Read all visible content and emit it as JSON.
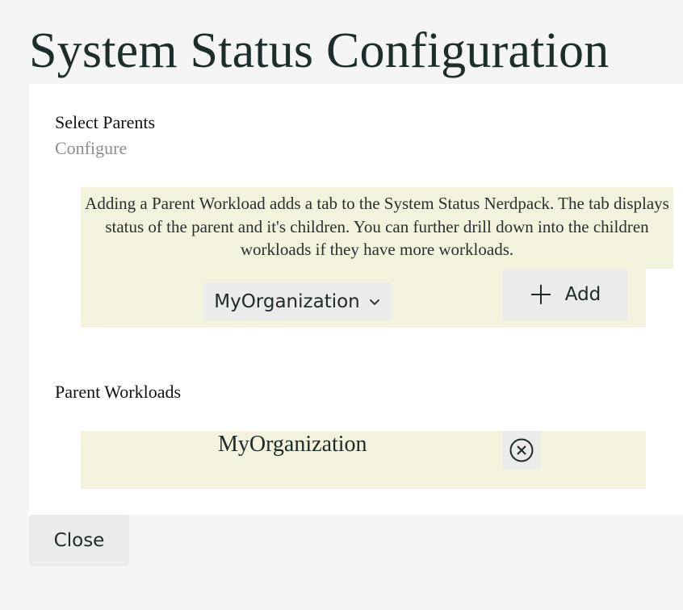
{
  "page": {
    "title": "System Status Configuration"
  },
  "select_parents": {
    "heading": "Select Parents",
    "subheading": "Configure",
    "info_text": "Adding a Parent Workload adds a tab to the System Status Nerdpack. The tab displays status of the parent and it's children. You can further drill down into the children workloads if they have more workloads.",
    "dropdown": {
      "selected": "MyOrganization",
      "icon": "chevron-down-icon"
    },
    "add_button": {
      "label": "Add",
      "icon": "plus-icon"
    }
  },
  "parent_workloads": {
    "heading": "Parent Workloads",
    "items": [
      {
        "name": "MyOrganization",
        "remove_icon": "close-circle-icon"
      }
    ]
  },
  "footer": {
    "close_label": "Close"
  }
}
